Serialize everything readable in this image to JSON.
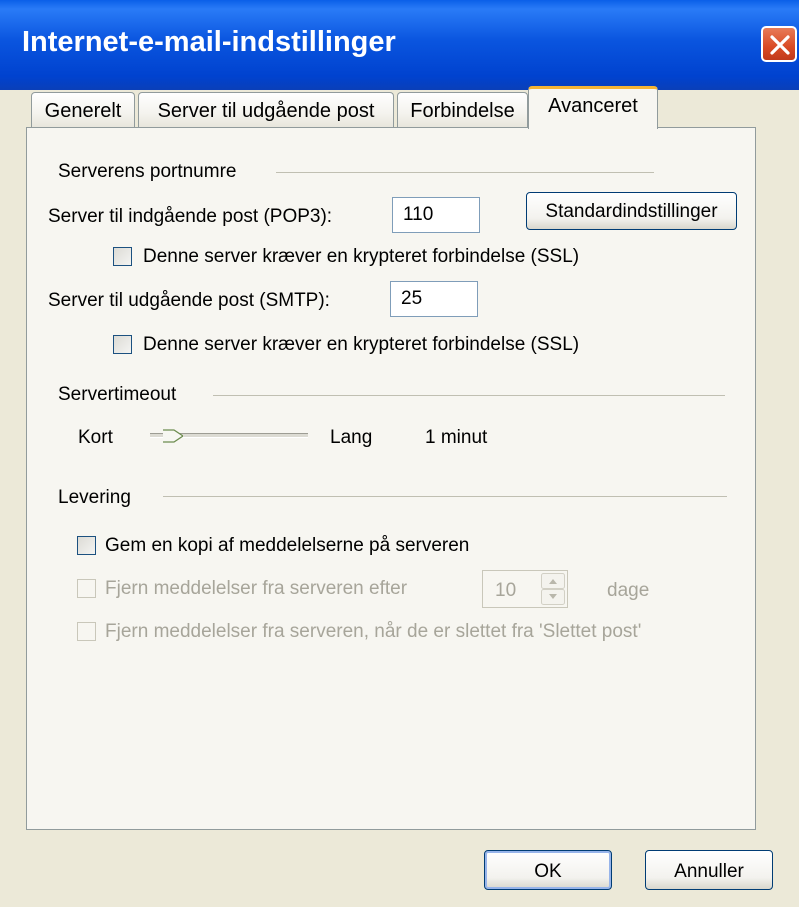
{
  "window": {
    "title": "Internet-e-mail-indstillinger"
  },
  "tabs": [
    {
      "label": "Generelt"
    },
    {
      "label": "Server til udgående post"
    },
    {
      "label": "Forbindelse"
    },
    {
      "label": "Avanceret",
      "active": true
    }
  ],
  "ports": {
    "group_label": "Serverens portnumre",
    "pop3_label": "Server til indgående post (POP3):",
    "pop3_value": "110",
    "pop3_ssl_label": "Denne server kræver en krypteret forbindelse (SSL)",
    "smtp_label": "Server til udgående post (SMTP):",
    "smtp_value": "25",
    "smtp_ssl_label": "Denne server kræver en krypteret forbindelse (SSL)",
    "defaults_button": "Standardindstillinger"
  },
  "timeout": {
    "group_label": "Servertimeout",
    "short_label": "Kort",
    "long_label": "Lang",
    "value_text": "1 minut",
    "slider_level": 0.1
  },
  "delivery": {
    "group_label": "Levering",
    "keep_copy_label": "Gem en kopi af meddelelserne på serveren",
    "remove_after_label": "Fjern meddelelser fra serveren efter",
    "remove_after_days": "10",
    "days_label": "dage",
    "remove_deleted_label": "Fjern meddelelser fra serveren, når de er slettet fra 'Slettet post'"
  },
  "buttons": {
    "ok": "OK",
    "cancel": "Annuller"
  },
  "colors": {
    "titlebar": "#0a55df",
    "close": "#d94a24",
    "tab_highlight": "#f5b535",
    "face": "#ece9d8"
  }
}
